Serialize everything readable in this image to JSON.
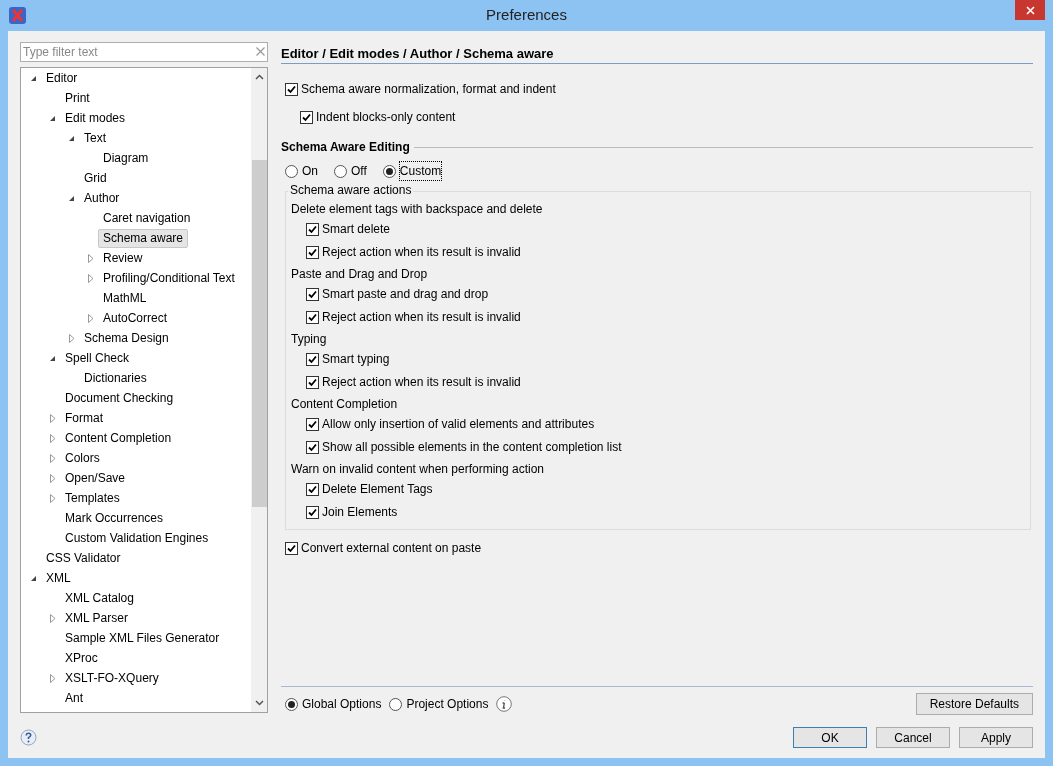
{
  "window": {
    "title": "Preferences"
  },
  "filter": {
    "placeholder": "Type filter text"
  },
  "tree": [
    {
      "label": "Editor",
      "expanded": true,
      "selected": false,
      "children": [
        {
          "label": "Print",
          "selected": false
        },
        {
          "label": "Edit modes",
          "expanded": true,
          "selected": false,
          "children": [
            {
              "label": "Text",
              "expanded": true,
              "selected": false,
              "children": [
                {
                  "label": "Diagram",
                  "selected": false
                }
              ]
            },
            {
              "label": "Grid",
              "selected": false
            },
            {
              "label": "Author",
              "expanded": true,
              "selected": false,
              "children": [
                {
                  "label": "Caret navigation",
                  "selected": false
                },
                {
                  "label": "Schema aware",
                  "selected": true
                },
                {
                  "label": "Review",
                  "expanded": false,
                  "selected": false
                },
                {
                  "label": "Profiling/Conditional Text",
                  "expanded": false,
                  "selected": false
                },
                {
                  "label": "MathML",
                  "selected": false
                },
                {
                  "label": "AutoCorrect",
                  "expanded": false,
                  "selected": false
                }
              ]
            },
            {
              "label": "Schema Design",
              "expanded": false,
              "selected": false
            }
          ]
        },
        {
          "label": "Spell Check",
          "expanded": true,
          "selected": false,
          "children": [
            {
              "label": "Dictionaries",
              "selected": false
            }
          ]
        },
        {
          "label": "Document Checking",
          "selected": false
        },
        {
          "label": "Format",
          "expanded": false,
          "selected": false
        },
        {
          "label": "Content Completion",
          "expanded": false,
          "selected": false
        },
        {
          "label": "Colors",
          "expanded": false,
          "selected": false
        },
        {
          "label": "Open/Save",
          "expanded": false,
          "selected": false
        },
        {
          "label": "Templates",
          "expanded": false,
          "selected": false
        },
        {
          "label": "Mark Occurrences",
          "selected": false
        },
        {
          "label": "Custom Validation Engines",
          "selected": false
        }
      ]
    },
    {
      "label": "CSS Validator",
      "selected": false
    },
    {
      "label": "XML",
      "expanded": true,
      "selected": false,
      "children": [
        {
          "label": "XML Catalog",
          "selected": false
        },
        {
          "label": "XML Parser",
          "expanded": false,
          "selected": false
        },
        {
          "label": "Sample XML Files Generator",
          "selected": false
        },
        {
          "label": "XProc",
          "selected": false
        },
        {
          "label": "XSLT-FO-XQuery",
          "expanded": false,
          "selected": false
        },
        {
          "label": "Ant",
          "selected": false
        }
      ]
    }
  ],
  "breadcrumb": "Editor / Edit modes / Author / Schema aware",
  "normalization": {
    "label": "Schema aware normalization, format and indent",
    "checked": true,
    "children": [
      {
        "label": "Indent blocks-only content",
        "checked": true
      }
    ]
  },
  "schema_aware_editing": {
    "title": "Schema Aware Editing",
    "modes": [
      {
        "label": "On",
        "selected": false
      },
      {
        "label": "Off",
        "selected": false
      },
      {
        "label": "Custom",
        "selected": true
      }
    ]
  },
  "actions": {
    "title": "Schema aware actions",
    "groups": [
      {
        "label": "Delete element tags with backspace and delete",
        "options": [
          {
            "label": "Smart delete",
            "checked": true
          },
          {
            "label": "Reject action when its result is invalid",
            "checked": true
          }
        ]
      },
      {
        "label": "Paste and Drag and Drop",
        "options": [
          {
            "label": "Smart paste and drag and drop",
            "checked": true
          },
          {
            "label": "Reject action when its result is invalid",
            "checked": true
          }
        ]
      },
      {
        "label": "Typing",
        "options": [
          {
            "label": "Smart typing",
            "checked": true
          },
          {
            "label": "Reject action when its result is invalid",
            "checked": true
          }
        ]
      },
      {
        "label": "Content Completion",
        "options": [
          {
            "label": "Allow only insertion of valid elements and attributes",
            "checked": true
          },
          {
            "label": "Show all possible elements in the content completion list",
            "checked": true
          }
        ]
      },
      {
        "label": "Warn on invalid content when performing action",
        "options": [
          {
            "label": "Delete Element Tags",
            "checked": true
          },
          {
            "label": "Join Elements",
            "checked": true
          }
        ]
      }
    ]
  },
  "convert": {
    "label": "Convert external content on paste",
    "checked": true
  },
  "scope": [
    {
      "label": "Global Options",
      "selected": true
    },
    {
      "label": "Project Options",
      "selected": false
    }
  ],
  "restore_button": "Restore Defaults",
  "buttons": [
    {
      "label": "OK",
      "default": true
    },
    {
      "label": "Cancel",
      "default": false
    },
    {
      "label": "Apply",
      "default": false
    }
  ]
}
